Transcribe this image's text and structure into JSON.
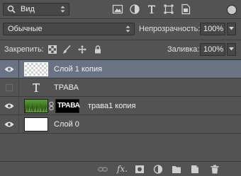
{
  "filter": {
    "kind_label": "Вид"
  },
  "blend": {
    "mode": "Обычные",
    "opacity_label": "Непрозрачность:",
    "opacity_value": "100%"
  },
  "lock": {
    "label": "Закрепить:",
    "fill_label": "Заливка:",
    "fill_value": "100%"
  },
  "layers": [
    {
      "name": "Слой 1 копия",
      "visible": true,
      "selected": true,
      "type": "pixel-transparent"
    },
    {
      "name": "ТРАВА",
      "visible": false,
      "selected": false,
      "type": "text"
    },
    {
      "name": "трава1 копия",
      "visible": true,
      "selected": false,
      "type": "pixel-with-mask",
      "mask_text": "ТРАВА"
    },
    {
      "name": "Слой 0",
      "visible": true,
      "selected": false,
      "type": "pixel-white"
    }
  ],
  "colors": {
    "panel_bg": "#535353",
    "selected_row": "#6a7383",
    "field_bg": "#474747",
    "grass_green": "#4e8a2e"
  },
  "icons": {
    "filter_bar": [
      "pixel-filter-icon",
      "adjustment-filter-icon",
      "type-filter-icon",
      "shape-filter-icon",
      "smart-object-filter-icon"
    ],
    "footer": [
      "link-layers-icon",
      "fx-icon",
      "add-mask-icon",
      "adjustment-layer-icon",
      "new-group-icon",
      "new-layer-icon",
      "trash-icon"
    ]
  }
}
